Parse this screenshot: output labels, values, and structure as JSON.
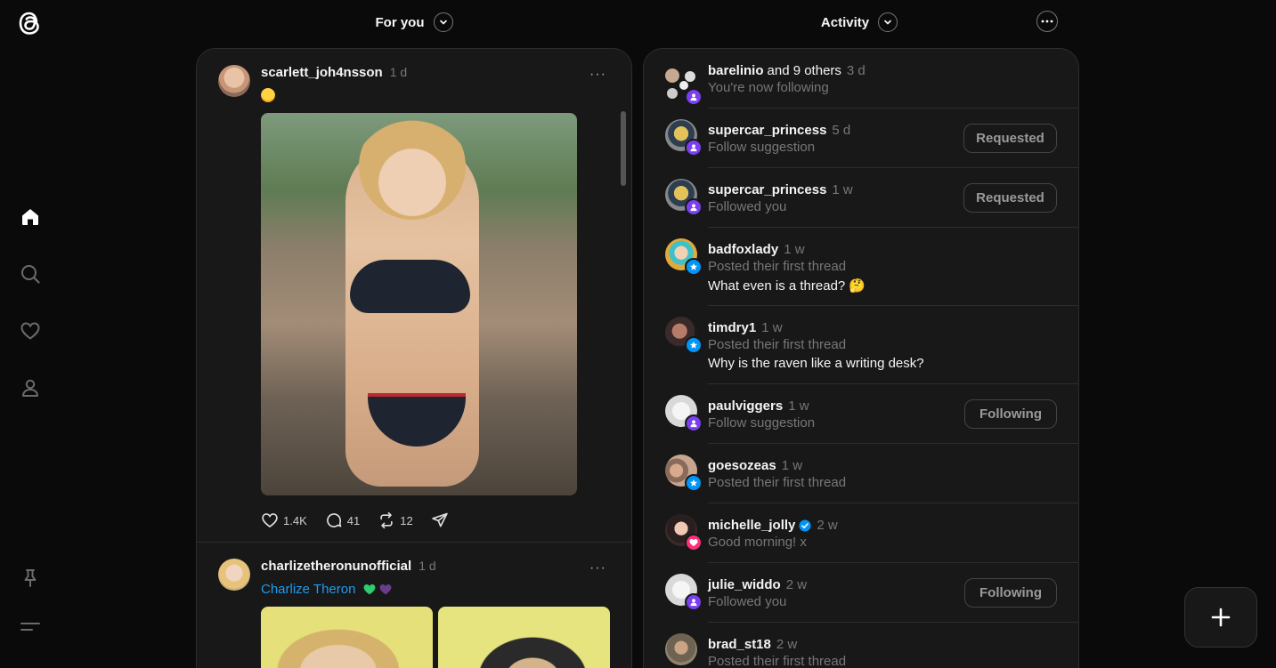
{
  "header": {
    "feed_label": "For you",
    "activity_label": "Activity"
  },
  "sidebar": {
    "items": [
      "home-icon",
      "search-icon",
      "heart-icon",
      "profile-icon",
      "pin-icon",
      "menu-icon"
    ]
  },
  "feed": {
    "posts": [
      {
        "username": "scarlett_joh4nsson",
        "time": "1 d",
        "likes": "1.4K",
        "replies": "41",
        "reposts": "12"
      },
      {
        "username": "charlizetheronunofficial",
        "time": "1 d",
        "caption_link": "Charlize Theron"
      }
    ]
  },
  "activity": {
    "rows": [
      {
        "name": "barelinio",
        "suffix": "and 9 others",
        "time": "3 d",
        "sub": "You're now following",
        "extra": "",
        "button": ""
      },
      {
        "name": "supercar_princess",
        "suffix": "",
        "time": "5 d",
        "sub": "Follow suggestion",
        "extra": "",
        "button": "Requested"
      },
      {
        "name": "supercar_princess",
        "suffix": "",
        "time": "1 w",
        "sub": "Followed you",
        "extra": "",
        "button": "Requested"
      },
      {
        "name": "badfoxlady",
        "suffix": "",
        "time": "1 w",
        "sub": "Posted their first thread",
        "extra": "What even is a thread? 🤔",
        "button": ""
      },
      {
        "name": "timdry1",
        "suffix": "",
        "time": "1 w",
        "sub": "Posted their first thread",
        "extra": "Why is the raven like a writing desk?",
        "button": ""
      },
      {
        "name": "paulviggers",
        "suffix": "",
        "time": "1 w",
        "sub": "Follow suggestion",
        "extra": "",
        "button": "Following"
      },
      {
        "name": "goesozeas",
        "suffix": "",
        "time": "1 w",
        "sub": "Posted their first thread",
        "extra": "",
        "button": ""
      },
      {
        "name": "michelle_jolly",
        "suffix": "",
        "time": "2 w",
        "sub": "Good morning! x",
        "extra": "",
        "button": ""
      },
      {
        "name": "julie_widdo",
        "suffix": "",
        "time": "2 w",
        "sub": "Followed you",
        "extra": "",
        "button": "Following"
      },
      {
        "name": "brad_st18",
        "suffix": "",
        "time": "2 w",
        "sub": "Posted their first thread",
        "extra": "",
        "button": ""
      }
    ]
  },
  "colors": {
    "background": "#0a0a0a",
    "column": "#181818",
    "follow_badge": "#7a3ff2",
    "thread_badge": "#0095f6",
    "like_badge": "#ff2f7a",
    "link": "#1d9bf0"
  }
}
